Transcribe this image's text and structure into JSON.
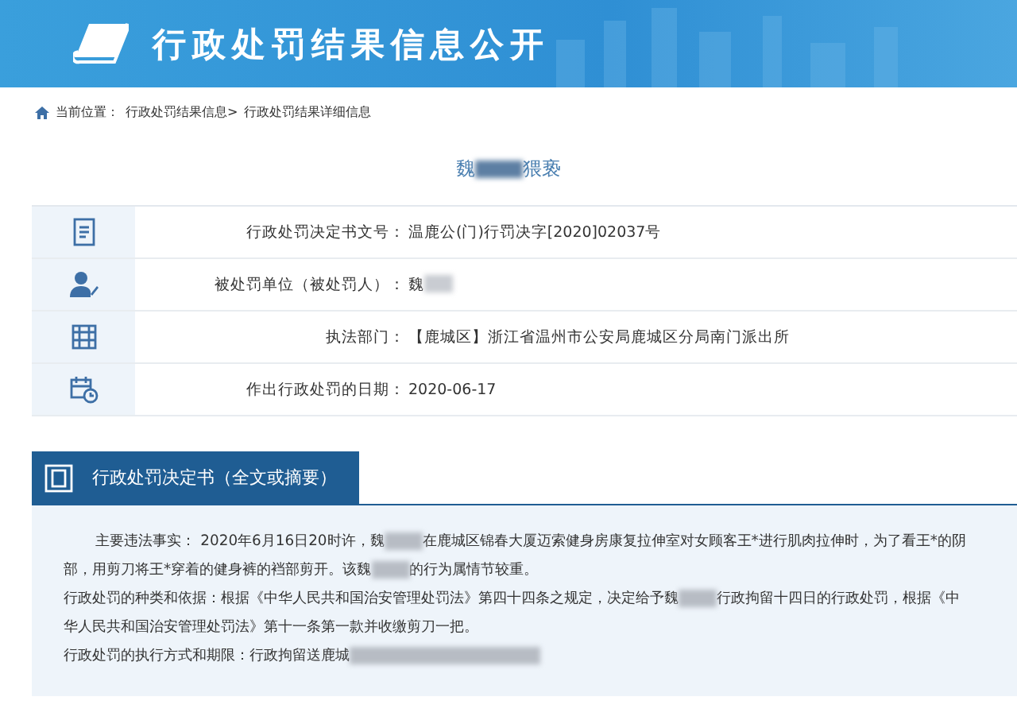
{
  "header": {
    "title": "行政处罚结果信息公开"
  },
  "breadcrumb": {
    "label": "当前位置：",
    "links": [
      "行政处罚结果信息>",
      "行政处罚结果详细信息"
    ]
  },
  "case_title": [
    {
      "kind": "text",
      "text": "魏"
    },
    {
      "kind": "redacted"
    },
    {
      "kind": "text",
      "text": "猥亵"
    }
  ],
  "info_rows": [
    {
      "label": "行政处罚决定书文号：",
      "value": [
        {
          "kind": "text",
          "text": "温鹿公(门)行罚决字[2020]02037号"
        }
      ]
    },
    {
      "label": "被处罚单位（被处罚人）：",
      "value": [
        {
          "kind": "text",
          "text": "魏"
        },
        {
          "kind": "redacted"
        }
      ]
    },
    {
      "label": "执法部门：",
      "value": [
        {
          "kind": "text",
          "text": "【鹿城区】浙江省温州市公安局鹿城区分局南门派出所"
        }
      ]
    },
    {
      "label": "作出行政处罚的日期：",
      "value": [
        {
          "kind": "text",
          "text": "2020-06-17"
        }
      ]
    }
  ],
  "section": {
    "title": "行政处罚决定书（全文或摘要）",
    "paragraphs": [
      {
        "indent": true,
        "parts": [
          {
            "kind": "text",
            "text": "主要违法事实： 2020年6月16日20时许，魏"
          },
          {
            "kind": "redacted"
          },
          {
            "kind": "text",
            "text": "在鹿城区锦春大厦迈索健身房康复拉伸室对女顾客王*进行肌肉拉伸时，为了看王*的阴部，用剪刀将王*穿着的健身裤的裆部剪开。该魏"
          },
          {
            "kind": "redacted"
          },
          {
            "kind": "text",
            "text": "的行为属情节较重。"
          }
        ]
      },
      {
        "indent": false,
        "parts": [
          {
            "kind": "text",
            "text": "行政处罚的种类和依据：根据《中华人民共和国治安管理处罚法》第四十四条之规定，决定给予魏"
          },
          {
            "kind": "redacted"
          },
          {
            "kind": "text",
            "text": "行政拘留十四日的行政处罚，根据《中华人民共和国治安管理处罚法》第十一条第一款并收缴剪刀一把。"
          }
        ]
      },
      {
        "indent": false,
        "parts": [
          {
            "kind": "text",
            "text": "行政处罚的执行方式和期限：行政拘留送鹿城"
          },
          {
            "kind": "redacted"
          }
        ]
      }
    ]
  }
}
